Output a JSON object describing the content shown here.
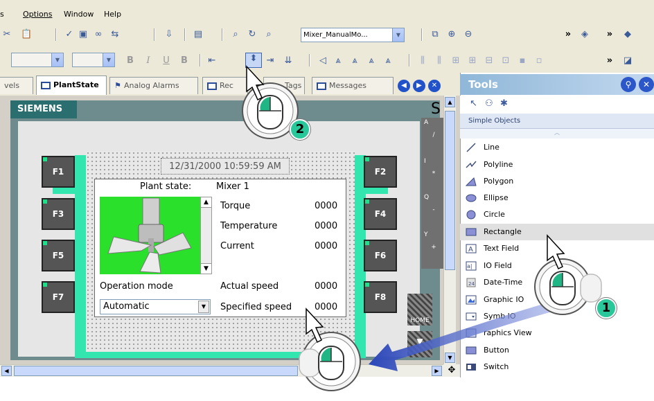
{
  "menu": {
    "items": [
      "s",
      "Options",
      "Window",
      "Help"
    ]
  },
  "toolbar": {
    "screen_combo": "Mixer_ManualMo...",
    "overflow_1": "»",
    "overflow_2": "»",
    "overflow_3": "»",
    "format_bold": "B",
    "format_italic": "I",
    "format_underline": "U",
    "format_b2": "B"
  },
  "tabs": [
    {
      "label": "vels"
    },
    {
      "label": "PlantState"
    },
    {
      "label": "Analog Alarms"
    },
    {
      "label": "Rec"
    },
    {
      "label": "Tags"
    },
    {
      "label": "Messages"
    }
  ],
  "hmi": {
    "brand": "SIEMENS",
    "corner_letter": "S",
    "datetime": "12/31/2000 10:59:59 AM",
    "plant_state_label": "Plant state:",
    "plant_state_value": "Mixer 1",
    "fkeys_left": [
      "F1",
      "F3",
      "F5",
      "F7"
    ],
    "fkeys_right": [
      "F2",
      "F4",
      "F6",
      "F8"
    ],
    "side_keys": [
      {
        "top": "A",
        "sub": "/"
      },
      {
        "top": "I",
        "sub": "*"
      },
      {
        "top": "Q",
        "sub": "-"
      },
      {
        "top": "Y",
        "sub": "+"
      }
    ],
    "home_label": "HOME",
    "fields": [
      {
        "label": "Torque",
        "value": "0000"
      },
      {
        "label": "Temperature",
        "value": "0000"
      },
      {
        "label": "Current",
        "value": "0000"
      },
      {
        "label": "Actual speed",
        "value": "0000"
      },
      {
        "label": "Specified speed",
        "value": "0000"
      }
    ],
    "operation_mode_label": "Operation mode",
    "operation_mode_value": "Automatic"
  },
  "tools": {
    "title": "Tools",
    "group": "Simple Objects",
    "items": [
      {
        "label": "Line",
        "icon": "line-icon"
      },
      {
        "label": "Polyline",
        "icon": "polyline-icon"
      },
      {
        "label": "Polygon",
        "icon": "polygon-icon"
      },
      {
        "label": "Ellipse",
        "icon": "ellipse-icon"
      },
      {
        "label": "Circle",
        "icon": "circle-icon"
      },
      {
        "label": "Rectangle",
        "icon": "rectangle-icon"
      },
      {
        "label": "Text Field",
        "icon": "text-field-icon"
      },
      {
        "label": "IO Field",
        "icon": "io-field-icon"
      },
      {
        "label": "Date-Time",
        "icon": "date-time-icon"
      },
      {
        "label": "Graphic IO",
        "icon": "graphic-io-icon"
      },
      {
        "label": "Symb      IO",
        "icon": "symbolic-io-icon"
      },
      {
        "label": "raphics View",
        "icon": "graphics-view-icon"
      },
      {
        "label": "Button",
        "icon": "button-icon"
      },
      {
        "label": "Switch",
        "icon": "switch-icon"
      }
    ]
  },
  "callouts": {
    "one": "1",
    "two": "2"
  },
  "colors": {
    "accent_green": "#33e6b0",
    "callout_green": "#2ac79a",
    "hmi_teal": "#2a6e6f",
    "tools_header": "#8fb7d8",
    "drag_arrow": "#2b46b8"
  }
}
